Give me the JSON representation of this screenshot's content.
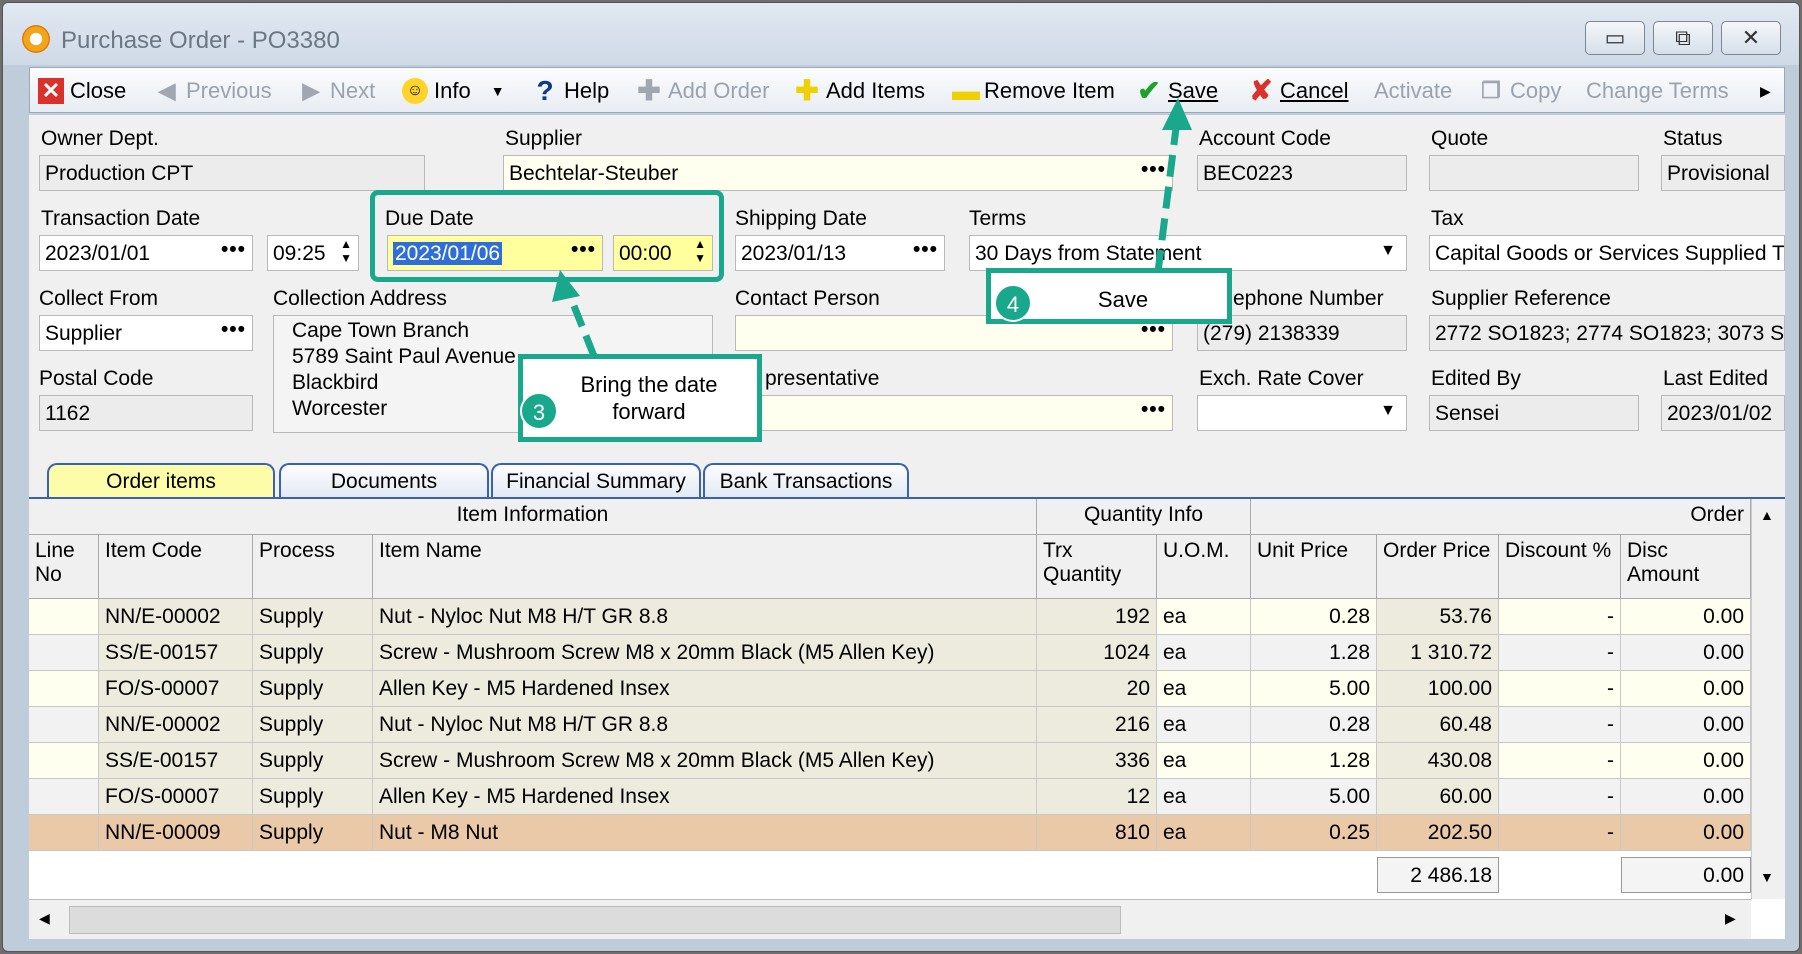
{
  "window": {
    "title": "Purchase Order - PO3380",
    "minimize": "▭",
    "restore": "⧉",
    "close": "✕"
  },
  "toolbar": {
    "close": "Close",
    "previous": "Previous",
    "next": "Next",
    "info": "Info",
    "help": "Help",
    "add_order": "Add Order",
    "add_items": "Add Items",
    "remove_item": "Remove Item",
    "save": "Save",
    "cancel": "Cancel",
    "activate": "Activate",
    "copy": "Copy",
    "change_terms": "Change Terms"
  },
  "form": {
    "owner_dept_label": "Owner Dept.",
    "owner_dept": "Production CPT",
    "supplier_label": "Supplier",
    "supplier": "Bechtelar-Steuber",
    "account_code_label": "Account Code",
    "account_code": "BEC0223",
    "quote_label": "Quote",
    "quote": "",
    "status_label": "Status",
    "status": "Provisional",
    "transaction_date_label": "Transaction Date",
    "transaction_date": "2023/01/01",
    "transaction_time": "09:25",
    "due_date_label": "Due Date",
    "due_date": "2023/01/06",
    "due_time": "00:00",
    "shipping_date_label": "Shipping Date",
    "shipping_date": "2023/01/13",
    "terms_label": "Terms",
    "terms": "30 Days from Statement",
    "tax_label": "Tax",
    "tax": "Capital Goods or Services Supplied T",
    "collect_from_label": "Collect From",
    "collect_from": "Supplier",
    "collection_address_label": "Collection Address",
    "collection_address": [
      "Cape Town Branch",
      "5789 Saint Paul Avenue",
      "Blackbird",
      "Worcester"
    ],
    "contact_person_label": "Contact Person",
    "contact_person": "",
    "telephone_label": "ephone Number",
    "telephone": "(279) 2138339",
    "supplier_reference_label": "Supplier Reference",
    "supplier_reference": "2772 SO1823; 2774 SO1823; 3073 S",
    "postal_code_label": "Postal Code",
    "postal_code": "1162",
    "representative_label": "presentative",
    "representative": "",
    "exch_rate_label": "Exch. Rate Cover",
    "exch_rate": "",
    "edited_by_label": "Edited By",
    "edited_by": "Sensei",
    "last_edited_label": "Last Edited",
    "last_edited": "2023/01/02"
  },
  "tabs": [
    "Order items",
    "Documents",
    "Financial Summary",
    "Bank Transactions"
  ],
  "grid": {
    "groups": {
      "item_info": "Item Information",
      "qty_info": "Quantity Info",
      "order": "Order"
    },
    "headers": {
      "line_no": "Line No",
      "item_code": "Item Code",
      "process": "Process",
      "item_name": "Item Name",
      "trx_qty": "Trx Quantity",
      "uom": "U.O.M.",
      "unit_price": "Unit Price",
      "order_price": "Order Price",
      "discount_pct": "Discount %",
      "disc_amount": "Disc Amount"
    },
    "rows": [
      {
        "code": "NN/E-00002",
        "process": "Supply",
        "name": "Nut - Nyloc Nut M8 H/T GR 8.8",
        "qty": "192",
        "uom": "ea",
        "unit": "0.28",
        "order": "53.76",
        "disc": "-",
        "amt": "0.00"
      },
      {
        "code": "SS/E-00157",
        "process": "Supply",
        "name": "Screw - Mushroom Screw M8 x 20mm Black (M5 Allen Key)",
        "qty": "1024",
        "uom": "ea",
        "unit": "1.28",
        "order": "1 310.72",
        "disc": "-",
        "amt": "0.00"
      },
      {
        "code": "FO/S-00007",
        "process": "Supply",
        "name": "Allen Key - M5 Hardened Insex",
        "qty": "20",
        "uom": "ea",
        "unit": "5.00",
        "order": "100.00",
        "disc": "-",
        "amt": "0.00"
      },
      {
        "code": "NN/E-00002",
        "process": "Supply",
        "name": "Nut - Nyloc Nut M8 H/T GR 8.8",
        "qty": "216",
        "uom": "ea",
        "unit": "0.28",
        "order": "60.48",
        "disc": "-",
        "amt": "0.00"
      },
      {
        "code": "SS/E-00157",
        "process": "Supply",
        "name": "Screw - Mushroom Screw M8 x 20mm Black (M5 Allen Key)",
        "qty": "336",
        "uom": "ea",
        "unit": "1.28",
        "order": "430.08",
        "disc": "-",
        "amt": "0.00"
      },
      {
        "code": "FO/S-00007",
        "process": "Supply",
        "name": "Allen Key - M5 Hardened Insex",
        "qty": "12",
        "uom": "ea",
        "unit": "5.00",
        "order": "60.00",
        "disc": "-",
        "amt": "0.00"
      },
      {
        "code": "NN/E-00009",
        "process": "Supply",
        "name": "Nut - M8 Nut",
        "qty": "810",
        "uom": "ea",
        "unit": "0.25",
        "order": "202.50",
        "disc": "-",
        "amt": "0.00"
      }
    ],
    "total_order": "2 486.18",
    "total_disc": "0.00"
  },
  "callouts": {
    "step3_num": "3",
    "step3_text": "Bring the date forward",
    "step4_num": "4",
    "step4_text": "Save"
  },
  "colors": {
    "accent": "#1aa88c",
    "selected_row": "#e9c9a8",
    "tab_active": "#fdfda9"
  }
}
